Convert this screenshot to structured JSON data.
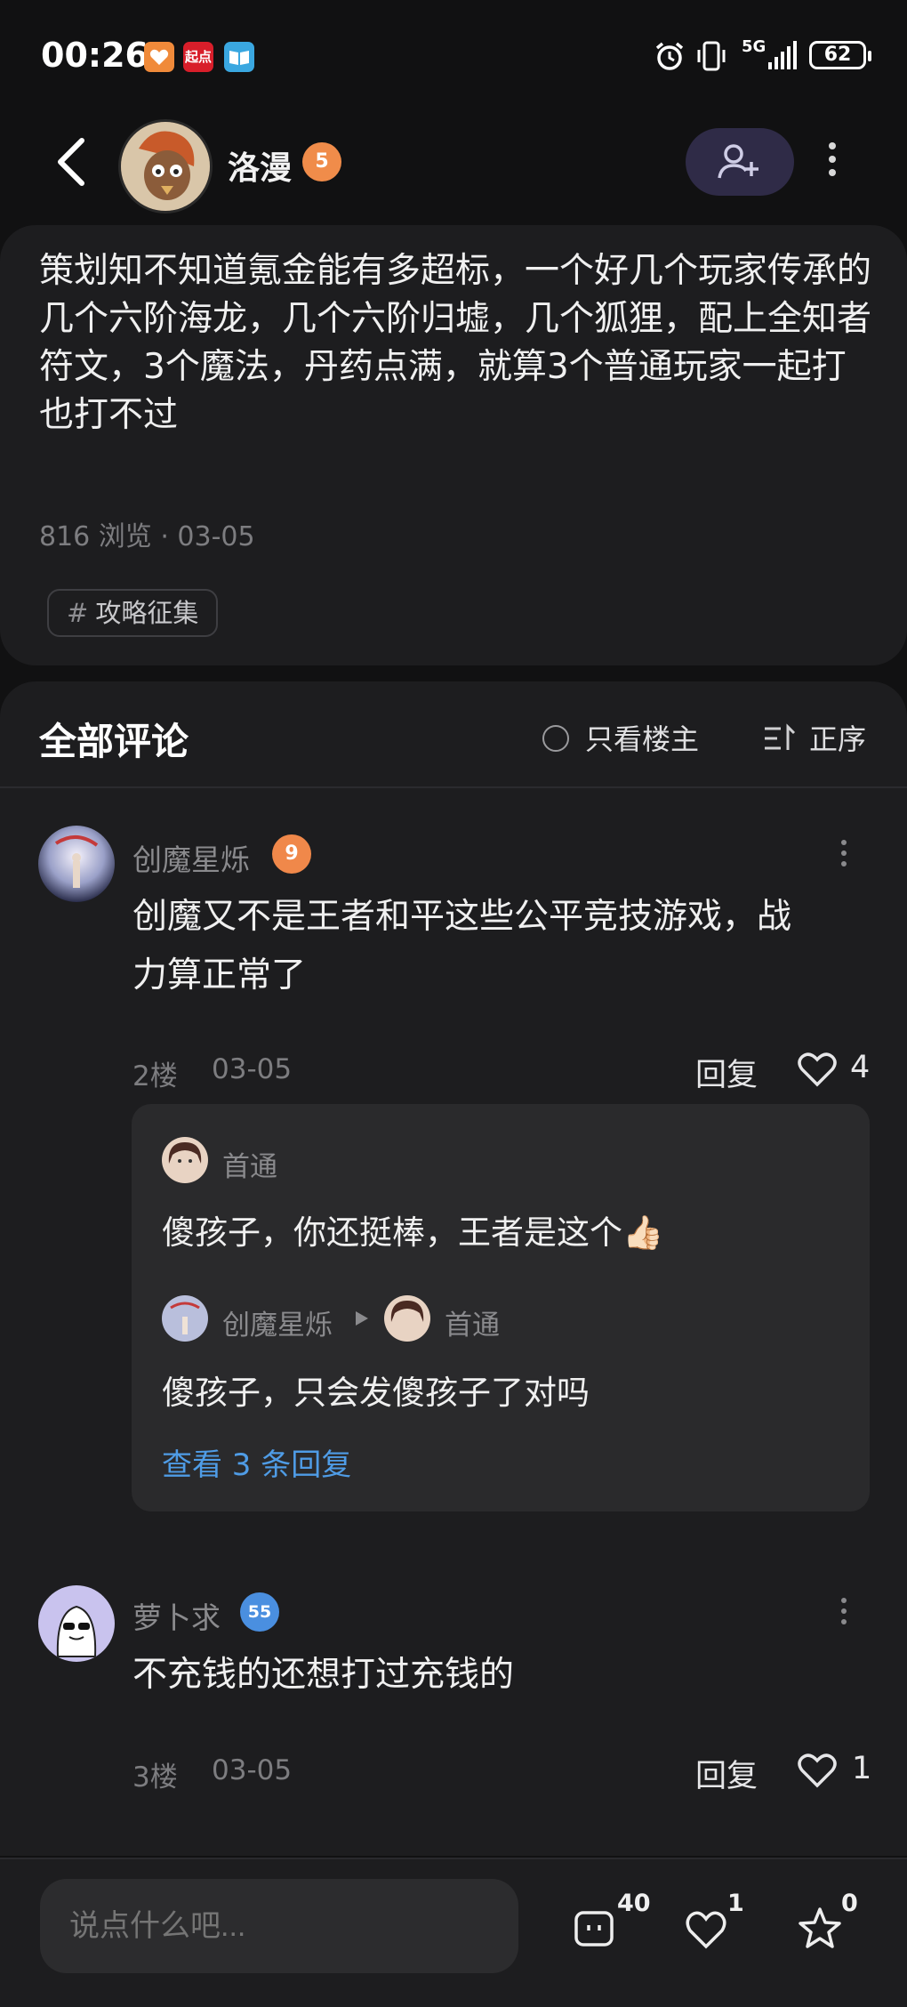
{
  "status_bar": {
    "time": "00:26",
    "app1": "",
    "app2": "起点",
    "network": "5G",
    "battery": "62"
  },
  "header": {
    "username": "洛漫",
    "level": "5"
  },
  "post": {
    "text": "策划知不知道氪金能有多超标，一个好几个玩家传承的几个六阶海龙，几个六阶归墟，几个狐狸，配上全知者符文，3个魔法，丹药点满，就算3个普通玩家一起打也打不过",
    "meta": "816 浏览 · 03-05",
    "tag_symbol": "#",
    "tag": "攻略征集"
  },
  "comments_section": {
    "title": "全部评论",
    "only_op": "只看楼主",
    "order": "正序"
  },
  "comments": [
    {
      "name": "创魔星烁",
      "level": "9",
      "text_line1": "创魔又不是王者和平这些公平竞技游戏，战",
      "text_line2": "力算正常了",
      "floor": "2楼",
      "date": "03-05",
      "reply_label": "回复",
      "likes": "4",
      "replies": [
        {
          "name": "首通",
          "text": "傻孩子，你还挺棒，王者是这个👍🏻"
        },
        {
          "name": "创魔星烁",
          "to": "首通",
          "text": "傻孩子，只会发傻孩子了对吗"
        }
      ],
      "view_more": "查看 3 条回复"
    },
    {
      "name": "萝卜求",
      "level": "55",
      "text_line1": "不充钱的还想打过充钱的",
      "floor": "3楼",
      "date": "03-05",
      "reply_label": "回复",
      "likes": "1"
    }
  ],
  "bottom_bar": {
    "placeholder": "说点什么吧...",
    "comment_count": "40",
    "like_count": "1",
    "fav_count": "0"
  },
  "colors": {
    "background": "#111112",
    "card": "#1d1d1f",
    "link": "#4f9ce6",
    "follow_button": "#2f2b47"
  }
}
